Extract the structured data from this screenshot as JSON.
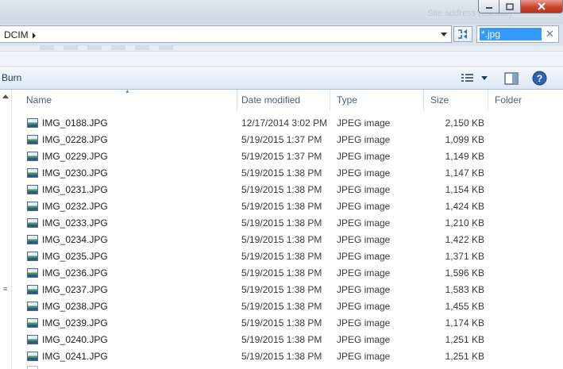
{
  "window": {
    "title_ghost": "Site address (Locatie)"
  },
  "address": {
    "breadcrumb": "DCIM"
  },
  "search": {
    "value": "*.jpg"
  },
  "toolbar": {
    "burn_label": "Burn"
  },
  "columns": {
    "name": "Name",
    "date": "Date modified",
    "type": "Type",
    "size": "Size",
    "folder": "Folder"
  },
  "icons": {
    "file": "jpeg-image-file-icon",
    "views": "change-view-icon",
    "preview": "preview-pane-icon",
    "help": "help-icon",
    "refresh": "search-refresh-icon"
  },
  "files": [
    {
      "name": "IMG_0188.JPG",
      "date": "12/17/2014 3:02 PM",
      "type": "JPEG image",
      "size": "2,150 KB"
    },
    {
      "name": "IMG_0228.JPG",
      "date": "5/19/2015 1:37 PM",
      "type": "JPEG image",
      "size": "1,099 KB"
    },
    {
      "name": "IMG_0229.JPG",
      "date": "5/19/2015 1:37 PM",
      "type": "JPEG image",
      "size": "1,149 KB"
    },
    {
      "name": "IMG_0230.JPG",
      "date": "5/19/2015 1:38 PM",
      "type": "JPEG image",
      "size": "1,147 KB"
    },
    {
      "name": "IMG_0231.JPG",
      "date": "5/19/2015 1:38 PM",
      "type": "JPEG image",
      "size": "1,154 KB"
    },
    {
      "name": "IMG_0232.JPG",
      "date": "5/19/2015 1:38 PM",
      "type": "JPEG image",
      "size": "1,424 KB"
    },
    {
      "name": "IMG_0233.JPG",
      "date": "5/19/2015 1:38 PM",
      "type": "JPEG image",
      "size": "1,210 KB"
    },
    {
      "name": "IMG_0234.JPG",
      "date": "5/19/2015 1:38 PM",
      "type": "JPEG image",
      "size": "1,422 KB"
    },
    {
      "name": "IMG_0235.JPG",
      "date": "5/19/2015 1:38 PM",
      "type": "JPEG image",
      "size": "1,371 KB"
    },
    {
      "name": "IMG_0236.JPG",
      "date": "5/19/2015 1:38 PM",
      "type": "JPEG image",
      "size": "1,596 KB"
    },
    {
      "name": "IMG_0237.JPG",
      "date": "5/19/2015 1:38 PM",
      "type": "JPEG image",
      "size": "1,583 KB"
    },
    {
      "name": "IMG_0238.JPG",
      "date": "5/19/2015 1:38 PM",
      "type": "JPEG image",
      "size": "1,455 KB"
    },
    {
      "name": "IMG_0239.JPG",
      "date": "5/19/2015 1:38 PM",
      "type": "JPEG image",
      "size": "1,174 KB"
    },
    {
      "name": "IMG_0240.JPG",
      "date": "5/19/2015 1:38 PM",
      "type": "JPEG image",
      "size": "1,251 KB"
    },
    {
      "name": "IMG_0241.JPG",
      "date": "5/19/2015 1:38 PM",
      "type": "JPEG image",
      "size": "1,251 KB"
    }
  ]
}
